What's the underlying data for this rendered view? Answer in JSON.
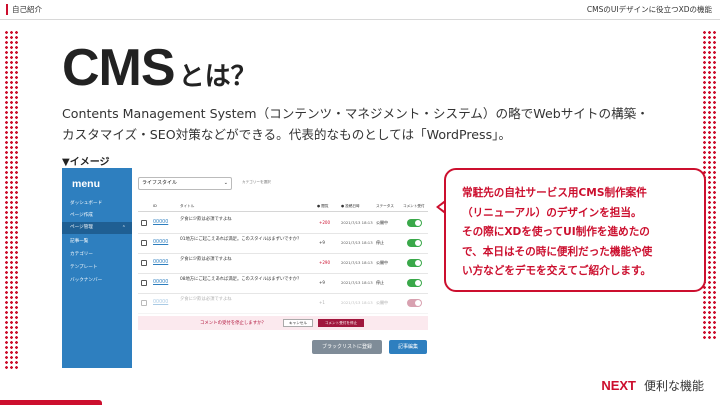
{
  "header": {
    "section": "自己紹介",
    "deck_title": "CMSのUIデザインに役立つXDの機能"
  },
  "title": {
    "main": "CMS",
    "suffix": "とは？"
  },
  "description": [
    "Contents Management System（コンテンツ・マネジメント・システム）の略でWebサイトの構築・",
    "カスタマイズ・SEO対策などができる。代表的なものとしては「WordPress」。"
  ],
  "image_label": "▼イメージ",
  "mock": {
    "logo": "menu",
    "sidebar": [
      {
        "label": "ダッシュボード"
      },
      {
        "label": "ページ作成"
      },
      {
        "label": "ページ管理",
        "active": true,
        "chevron": "⌃"
      },
      {
        "label": "記事一覧"
      },
      {
        "label": "カテゴリー"
      },
      {
        "label": "テンプレート"
      },
      {
        "label": "バックナンバー"
      }
    ],
    "filter": {
      "value": "ライフスタイル",
      "caret": "⌄"
    },
    "category_note": "カテゴリーを選択",
    "columns": {
      "id": "ID",
      "title": "タイトル",
      "pv": "● 閲覧",
      "date": "● 投稿日時",
      "status": "ステータス",
      "comment": "コメント受付"
    },
    "rows": [
      {
        "id": "00000",
        "title": "夕食に少飲は必須ですよね",
        "num": "+200",
        "date": "2021/7/13 18:13",
        "status": "公開中",
        "toggle": "on"
      },
      {
        "id": "00000",
        "title": "01地方にご起こえあれば満足。このスタイルはまずいですか？",
        "num": "+9",
        "date": "2021/7/13 18:13",
        "status": "停止",
        "toggle": "on"
      },
      {
        "id": "00000",
        "title": "夕食に少飲は必須ですよね",
        "num": "+290",
        "date": "2021/7/13 18:13",
        "status": "公開中",
        "toggle": "on"
      },
      {
        "id": "00000",
        "title": "08地方にご起こえあれば満足。このスタイルはまずいですか？",
        "num": "+9",
        "date": "2021/7/13 18:13",
        "status": "停止",
        "toggle": "on"
      },
      {
        "id": "00000",
        "title": "夕食に少飲は必須ですよね",
        "num": "+1",
        "date": "2021/7/13 18:13",
        "status": "公開中",
        "toggle": "off",
        "faded": true
      }
    ],
    "confirm": {
      "question": "コメントの受付を停止しますか？",
      "cancel": "キャンセル",
      "ok": "コメント受付を停止"
    },
    "buttons": {
      "blacklist": "ブラックリストに登録",
      "edit": "記事編集"
    }
  },
  "callout": [
    "常駐先の自社サービス用CMS制作案件",
    "（リニューアル）のデザインを担当。",
    "その際にXDを使ってUI制作を進めたの",
    "で、本日はその時に便利だった機能や使",
    "い方などをデモを交えてご紹介します。"
  ],
  "next": {
    "keyword": "NEXT",
    "topic": "便利な機能"
  },
  "colors": {
    "accent": "#cc0f2e",
    "sidebar": "#2e7fbf",
    "toggle_on": "#3aa84a",
    "toggle_off": "#a0173d"
  }
}
